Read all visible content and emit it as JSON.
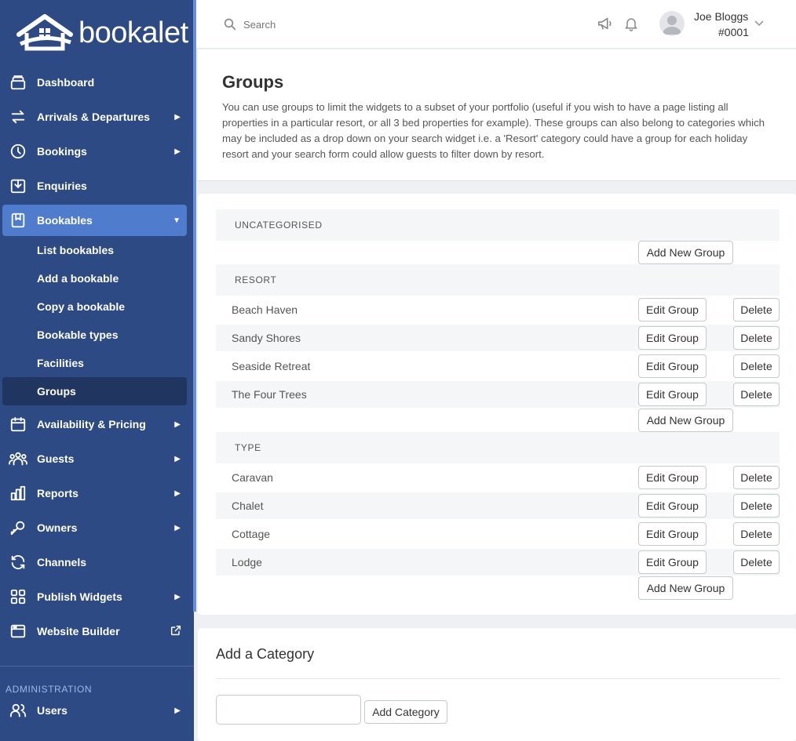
{
  "brand": {
    "name": "bookalet"
  },
  "sidebar": {
    "items": [
      {
        "label": "Dashboard",
        "icon": "stack-icon"
      },
      {
        "label": "Arrivals & Departures",
        "icon": "arrows-swap-icon"
      },
      {
        "label": "Bookings",
        "icon": "clock-icon"
      },
      {
        "label": "Enquiries",
        "icon": "inbox-icon"
      },
      {
        "label": "Bookables",
        "icon": "bookmark-icon"
      },
      {
        "label": "Availability & Pricing",
        "icon": "calendar-icon"
      },
      {
        "label": "Guests",
        "icon": "users-icon"
      },
      {
        "label": "Reports",
        "icon": "bar-chart-icon"
      },
      {
        "label": "Owners",
        "icon": "key-icon"
      },
      {
        "label": "Channels",
        "icon": "refresh-icon"
      },
      {
        "label": "Publish Widgets",
        "icon": "grid-icon"
      },
      {
        "label": "Website Builder",
        "icon": "browser-icon"
      }
    ],
    "sub_items": [
      "List bookables",
      "Add a bookable",
      "Copy a bookable",
      "Bookable types",
      "Facilities",
      "Groups"
    ],
    "admin_label": "ADMINISTRATION",
    "admin_items": [
      {
        "label": "Users",
        "icon": "user-icon"
      }
    ]
  },
  "header": {
    "search_placeholder": "Search",
    "user_name": "Joe Bloggs",
    "user_id": "#0001"
  },
  "intro": {
    "title": "Groups",
    "description": "You can use groups to limit the widgets to a subset of your portfolio (useful if you wish to have a page listing all properties in a particular resort, or all 3 bed properties for example). These groups can also belong to categories which may be included as a drop down on your search widget i.e. a 'Resort' category could have a group for each holiday resort and your search form could allow guests to filter down by resort."
  },
  "groups": {
    "categories": [
      {
        "name": "UNCATEGORISED",
        "items": []
      },
      {
        "name": "RESORT",
        "items": [
          "Beach Haven",
          "Sandy Shores",
          "Seaside Retreat",
          "The Four Trees"
        ]
      },
      {
        "name": "TYPE",
        "items": [
          "Caravan",
          "Chalet",
          "Cottage",
          "Lodge"
        ]
      }
    ],
    "edit_label": "Edit Group",
    "delete_label": "Delete",
    "add_label": "Add New Group"
  },
  "add_category": {
    "title": "Add a Category",
    "input_value": "",
    "button_label": "Add Category"
  },
  "colors": {
    "sidebar_bg": "#2d4a85",
    "sidebar_active": "#4f7ccc",
    "sidebar_current": "#20355f",
    "admin_label": "#9cb8ec"
  }
}
